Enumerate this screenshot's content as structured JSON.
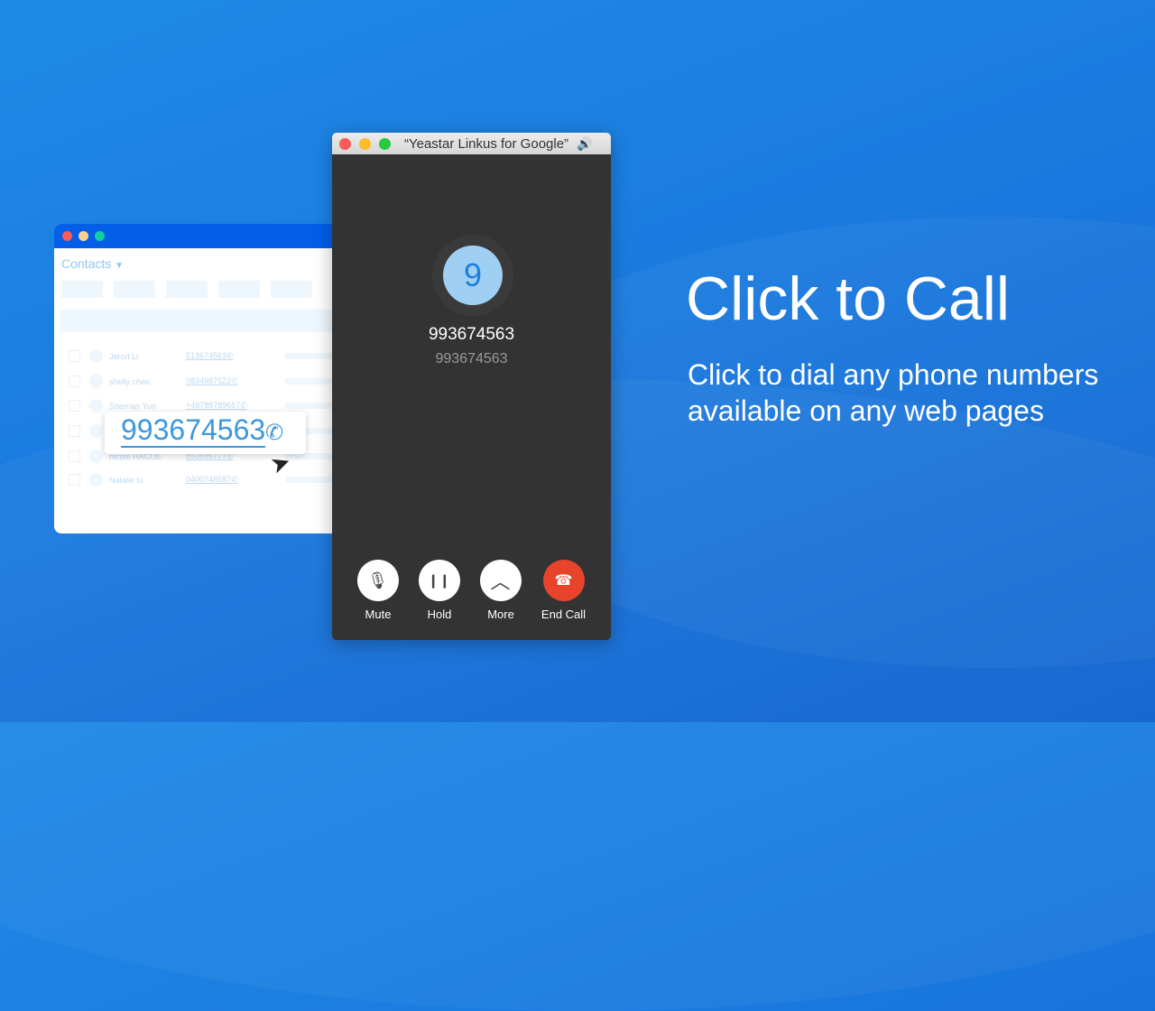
{
  "contacts_window": {
    "title": "Contacts",
    "rows": [
      {
        "name": "Jarod Li",
        "phone": "513674563"
      },
      {
        "name": "shelly chen",
        "phone": "0834987522"
      },
      {
        "name": "Shernan Yun",
        "phone": "+48788789657"
      },
      {
        "name": "",
        "phone": ""
      },
      {
        "name": "nicole HAGUE",
        "phone": "860696777"
      },
      {
        "name": "Natalie lu",
        "phone": "0400748587"
      }
    ],
    "popup_number": "993674563"
  },
  "call_window": {
    "title": "“Yeastar Linkus for Google”",
    "avatar_initial": "9",
    "caller_name": "993674563",
    "caller_number": "993674563",
    "buttons": [
      {
        "label": "Mute",
        "icon": "microphone-icon"
      },
      {
        "label": "Hold",
        "icon": "pause-icon"
      },
      {
        "label": "More",
        "icon": "chevron-up-icon"
      },
      {
        "label": "End Call",
        "icon": "hang-up-icon"
      }
    ],
    "end_color": "#e8442c"
  },
  "headline": "Click to Call",
  "subheadline": "Click to dial any phone numbers available on any web pages"
}
